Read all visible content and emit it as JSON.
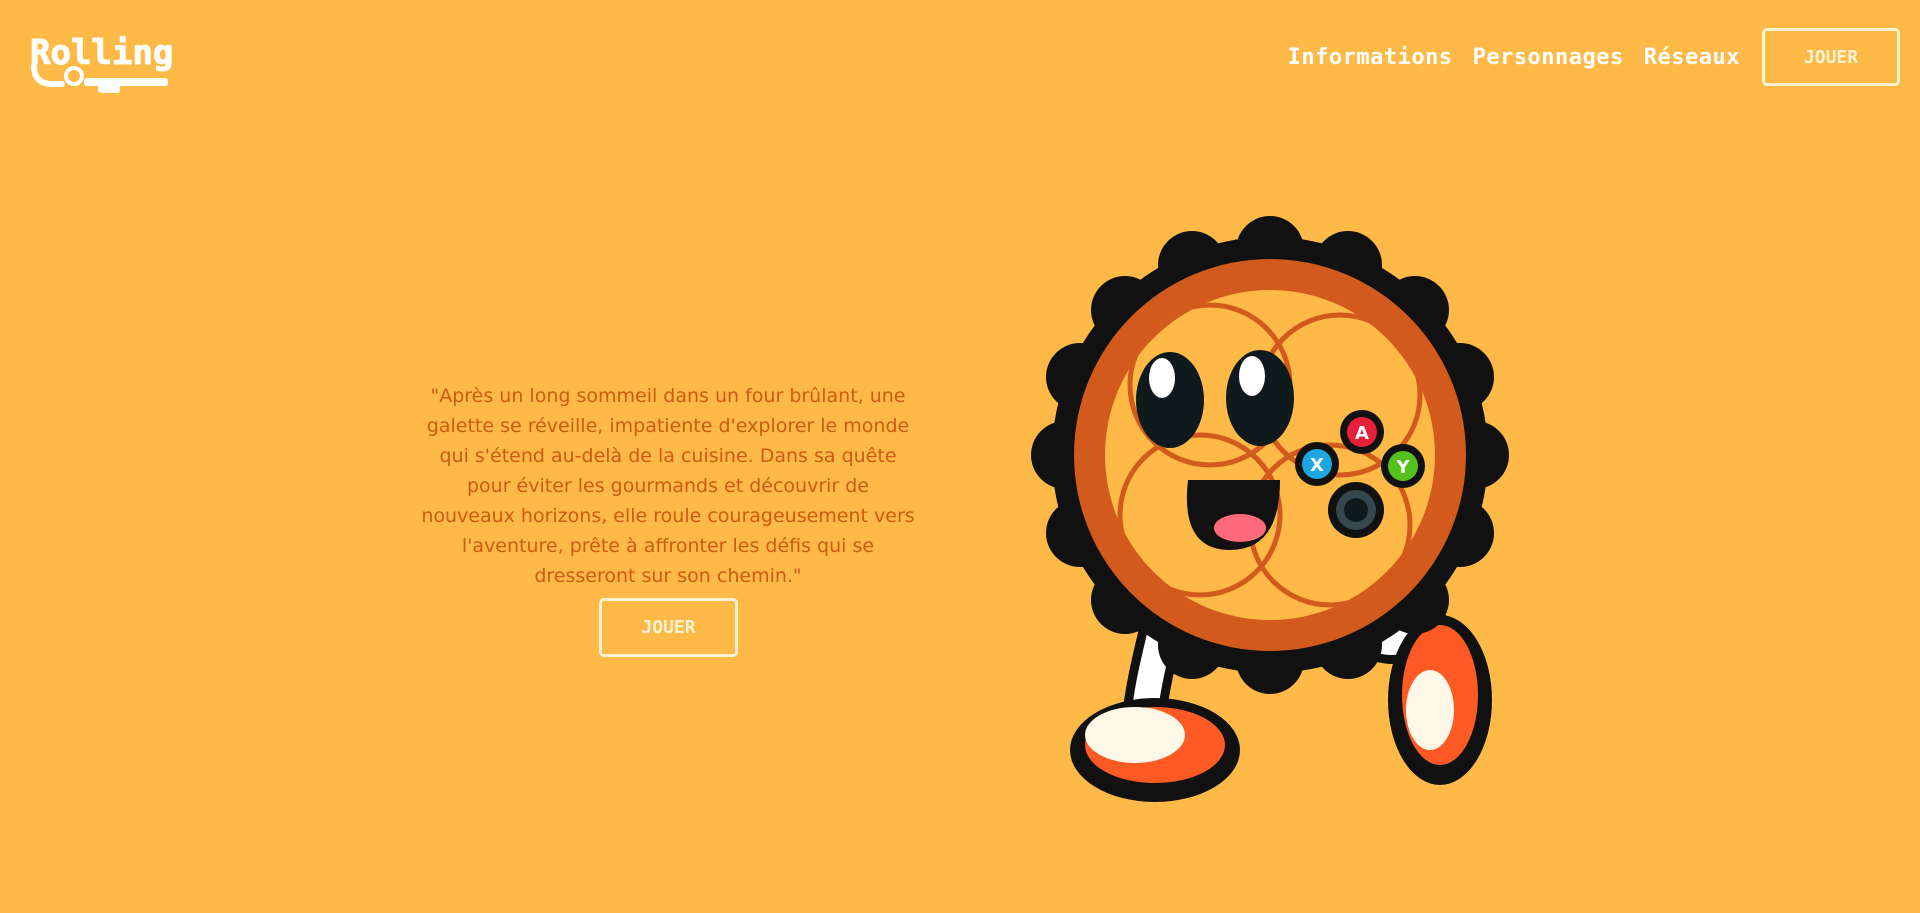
{
  "header": {
    "logo_text": "Rolling",
    "nav": [
      {
        "label": "Informations"
      },
      {
        "label": "Personnages"
      },
      {
        "label": "Réseaux"
      }
    ],
    "play_button": "JOUER"
  },
  "hero": {
    "story": "\"Après un long sommeil dans un four brûlant, une galette se réveille, impatiente d'explorer le monde qui s'étend au-delà de la cuisine. Dans sa quête pour éviter les gourmands et découvrir de nouveaux horizons, elle roule courageusement vers l'aventure, prête à affronter les défis qui se dresseront sur son chemin.\"",
    "play_button": "JOUER",
    "mascot_buttons": [
      "A",
      "X",
      "Y"
    ]
  },
  "colors": {
    "background": "#ffb947",
    "text_accent": "#cf5a12",
    "button_border": "#fff2d3"
  },
  "icons": [
    "logo-icon",
    "galette-mascot-icon",
    "controller-buttons-icon"
  ]
}
